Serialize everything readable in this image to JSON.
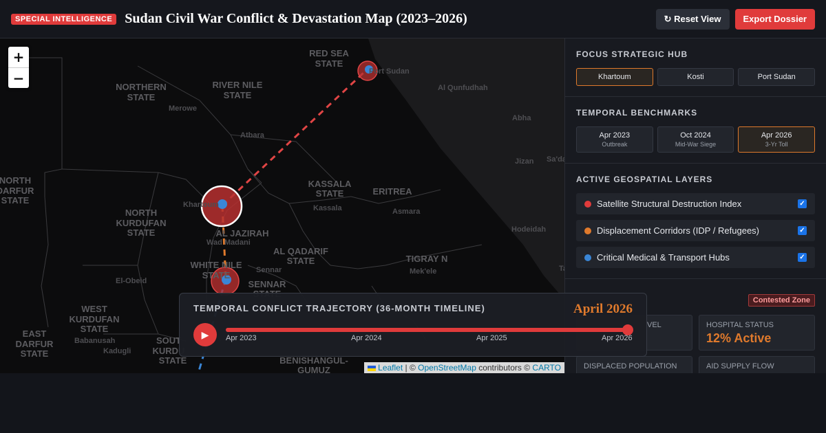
{
  "header": {
    "badge": "SPECIAL INTELLIGENCE",
    "title": "Sudan Civil War Conflict & Devastation Map (2023–2026)",
    "reset_label": "↻ Reset View",
    "export_label": "Export Dossier"
  },
  "map": {
    "zoom_in": "+",
    "zoom_out": "−",
    "labels": {
      "red_sea": "RED SEA",
      "red_sea_state": "STATE",
      "northern": "NORTHERN",
      "northern_state": "STATE",
      "river_nile": "RIVER NILE",
      "river_nile_state": "STATE",
      "north_darfur_1": "NORTH",
      "north_darfur_2": "DARFUR",
      "north_darfur_3": "STATE",
      "north_kordofan_1": "NORTH",
      "north_kordofan_2": "KURDUFAN",
      "north_kordofan_3": "STATE",
      "kassala": "KASSALA",
      "kassala_state": "STATE",
      "eritrea": "ERITREA",
      "al_jazirah": "AL JAZIRAH",
      "al_qadarif": "AL QADARIF",
      "al_qadarif_state": "STATE",
      "white_nile": "WHITE NILE",
      "white_nile_state": "STATE",
      "sennar": "SENNAR",
      "sennar_state": "STATE",
      "tigray": "TIGRAY N",
      "west_kordofan_1": "WEST",
      "west_kordofan_2": "KURDUFAN",
      "west_kordofan_3": "STATE",
      "east_darfur_1": "EAST",
      "east_darfur_2": "DARFUR",
      "east_darfur_3": "STATE",
      "south_kordofan_1": "SOUT",
      "south_kordofan_2": "KURDU",
      "south_kordofan_3": "STATE",
      "benishangul_1": "BENISHANGUL-",
      "benishangul_2": "GUMUZ",
      "port_sudan": "Port Sudan",
      "al_qunfudhah": "Al Qunfudhah",
      "abha": "Abha",
      "merowe": "Merowe",
      "atbara": "Atbara",
      "jizan": "Jizan",
      "sa_da": "Sa'da",
      "khartoum": "Khartoum",
      "kassala_city": "Kassala",
      "asmara": "Asmara",
      "hodeidah": "Hodeidah",
      "wad_madani": "Wad Madani",
      "sennar_city": "Sennar",
      "el_obeid": "El-Obeid",
      "mekele": "Mek'ele",
      "babanusah": "Babanusah",
      "kadugli": "Kadugli",
      "ta": "Ta"
    },
    "attribution": {
      "leaflet": "Leaflet",
      "sep": " | © ",
      "osm": "OpenStreetMap",
      "contrib": " contributors © ",
      "carto": "CARTO"
    }
  },
  "timeline": {
    "title": "TEMPORAL CONFLICT TRAJECTORY (36-MONTH TIMELINE)",
    "current_label": "April 2026",
    "play_icon": "▶",
    "progress": 1.0,
    "ticks": [
      "Apr 2023",
      "Apr 2024",
      "Apr 2025",
      "Apr 2026"
    ]
  },
  "panel": {
    "hubs_title": "FOCUS STRATEGIC HUB",
    "hubs": [
      "Khartoum",
      "Kosti",
      "Port Sudan"
    ],
    "hub_active": 0,
    "bench_title": "TEMPORAL BENCHMARKS",
    "benchmarks": [
      {
        "date": "Apr 2023",
        "sub": "Outbreak"
      },
      {
        "date": "Oct 2024",
        "sub": "Mid-War Siege"
      },
      {
        "date": "Apr 2026",
        "sub": "3-Yr Toll"
      }
    ],
    "bench_active": 2,
    "layers_title": "ACTIVE GEOSPATIAL LAYERS",
    "layers": [
      {
        "label": "Satellite Structural Destruction Index",
        "color": "#e03b3b",
        "checked": true
      },
      {
        "label": "Displacement Corridors (IDP / Refugees)",
        "color": "#e07a2c",
        "checked": true
      },
      {
        "label": "Critical Medical & Transport Hubs",
        "color": "#3a86d6",
        "checked": true
      }
    ],
    "contested": "Contested Zone",
    "stats": {
      "level_label": "VEL",
      "hospital_label": "HOSPITAL STATUS",
      "hospital_value": "12% Active",
      "displaced_label": "DISPLACED POPULATION",
      "aid_label": "AID SUPPLY FLOW"
    }
  }
}
